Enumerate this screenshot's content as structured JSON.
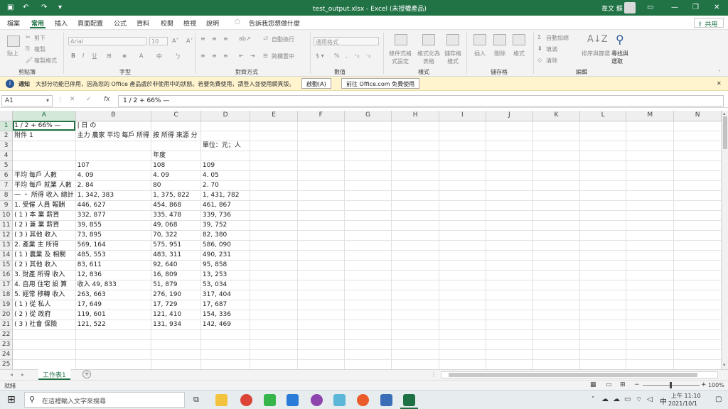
{
  "title_bar": {
    "file_title": "test_output.xlsx  -  Excel (未授權產品)",
    "user": "韋文 蘇",
    "controls": [
      "minimize-icon",
      "restore-icon",
      "close-icon"
    ]
  },
  "ribbon_tabs": [
    {
      "label": "檔案"
    },
    {
      "label": "常用"
    },
    {
      "label": "插入"
    },
    {
      "label": "頁面配置"
    },
    {
      "label": "公式"
    },
    {
      "label": "資料"
    },
    {
      "label": "校閱"
    },
    {
      "label": "檢視"
    },
    {
      "label": "說明"
    }
  ],
  "active_tab": "常用",
  "tell_me": "告訴我您想做什麼",
  "share_label": "共用",
  "ribbon": {
    "clipboard": {
      "paste": "貼上",
      "cut": "剪下",
      "copy": "複製",
      "format_painter": "複製格式",
      "group": "剪貼簿"
    },
    "font": {
      "name": "Arial",
      "size": "10",
      "group": "字型"
    },
    "alignment": {
      "wrap": "自動換行",
      "merge": "跨欄置中",
      "group": "對齊方式"
    },
    "number": {
      "format": "通用格式",
      "group": "數值"
    },
    "styles": {
      "conditional": "條件式格式設定",
      "table": "格式化為表格",
      "cell_styles": "儲存格樣式",
      "group": "樣式"
    },
    "cells": {
      "insert": "插入",
      "delete": "刪除",
      "format": "格式",
      "group": "儲存格"
    },
    "editing": {
      "autosum": "自動加總",
      "fill": "填滿",
      "clear": "清除",
      "sort": "排序與篩選",
      "find": "尋找與選取",
      "group": "編輯"
    }
  },
  "info_bar": {
    "label": "通知",
    "message": "大部分功能已停用，因為您的 Office 產品處於非使用中的狀態。若要免費使用，請登入並使用網頁版。",
    "activate_button": "啟動(A)",
    "web_button": "前往 Office.com 免費使用"
  },
  "formula_bar": {
    "name_box": "A1",
    "fx": "fx",
    "formula": "1 / 2 + 66% —"
  },
  "columns": [
    "A",
    "B",
    "C",
    "D",
    "E",
    "F",
    "G",
    "H",
    "I",
    "J",
    "K",
    "L",
    "M",
    "N"
  ],
  "rows": [
    {
      "n": "1",
      "a": "1 / 2 + 66% —",
      "b": "| 日 の",
      "c": "",
      "d": ""
    },
    {
      "n": "2",
      "a": "附件 1",
      "b": "主力 農家 平均 每戶 所得",
      "c": "按 所得 來源 分",
      "d": ""
    },
    {
      "n": "3",
      "a": "",
      "b": "",
      "c": "",
      "d": "單位：元；人"
    },
    {
      "n": "4",
      "a": "",
      "b": "",
      "c": "年度",
      "d": ""
    },
    {
      "n": "5",
      "a": "",
      "b": "107",
      "c": "108",
      "d": "109"
    },
    {
      "n": "6",
      "a": "平均 每戶 人數",
      "b": "4. 09",
      "c": "4. 09",
      "d": "4. 05"
    },
    {
      "n": "7",
      "a": "平均 每戶 就業 人數",
      "b": "2. 84",
      "c": "80",
      "d": "2. 70"
    },
    {
      "n": "8",
      "a": "一 ・ 所得 收入 總計",
      "b": "1, 342, 383",
      "c": "1, 375, 822",
      "d": "1, 431, 782"
    },
    {
      "n": "9",
      "a": "1. 受僱 人員 報酬",
      "b": "446, 627",
      "c": "454, 868",
      "d": "461, 867"
    },
    {
      "n": "10",
      "a": "( 1 ) 本 業 薪資",
      "b": "332, 877",
      "c": "335, 478",
      "d": "339, 736"
    },
    {
      "n": "11",
      "a": "( 2 ) 兼 業 薪資",
      "b": "39, 855",
      "c": "49, 068",
      "d": "39, 752"
    },
    {
      "n": "12",
      "a": "( 3 ) 其他 收入",
      "b": "73, 895",
      "c": "70, 322",
      "d": "82, 380"
    },
    {
      "n": "13",
      "a": "2. 產業 主 所得",
      "b": "569, 164",
      "c": "575, 951",
      "d": "586, 090"
    },
    {
      "n": "14",
      "a": "( 1 ) 農業 及 相關",
      "b": "485, 553",
      "c": "483, 311",
      "d": "490, 231"
    },
    {
      "n": "15",
      "a": "( 2 ) 其他 收入",
      "b": "83, 611",
      "c": "92, 640",
      "d": "95, 858"
    },
    {
      "n": "16",
      "a": "3. 財產 所得 收入",
      "b": "12, 836",
      "c": "16, 809",
      "d": "13, 253"
    },
    {
      "n": "17",
      "a": "4. 自用 住宅 設 算",
      "b": "收入 49, 833",
      "c": "51, 879",
      "d": "53, 034"
    },
    {
      "n": "18",
      "a": "5. 經常 移轉 收入",
      "b": "263, 663",
      "c": "276, 190",
      "d": "317, 404"
    },
    {
      "n": "19",
      "a": "( 1 ) 從 私人",
      "b": "17, 649",
      "c": "17, 729",
      "d": "17, 687"
    },
    {
      "n": "20",
      "a": "( 2 ) 從 政府",
      "b": "119, 601",
      "c": "121, 410",
      "d": "154, 336"
    },
    {
      "n": "21",
      "a": "( 3 ) 社會 保險",
      "b": "121, 522",
      "c": "131, 934",
      "d": "142, 469"
    },
    {
      "n": "22",
      "a": "",
      "b": "",
      "c": "",
      "d": ""
    },
    {
      "n": "23",
      "a": "",
      "b": "",
      "c": "",
      "d": ""
    },
    {
      "n": "24",
      "a": "",
      "b": "",
      "c": "",
      "d": ""
    },
    {
      "n": "25",
      "a": "",
      "b": "",
      "c": "",
      "d": ""
    }
  ],
  "sheet_tabs": [
    {
      "label": "工作表1"
    }
  ],
  "status": {
    "ready": "就緒",
    "zoom": "100%"
  },
  "taskbar": {
    "search_placeholder": "在這裡輸入文字來搜尋",
    "time": "上午 11:10",
    "date": "2021/10/1",
    "ime": "中"
  },
  "colors": {
    "excel_green": "#217346",
    "info_yellow": "#fff4ce"
  }
}
